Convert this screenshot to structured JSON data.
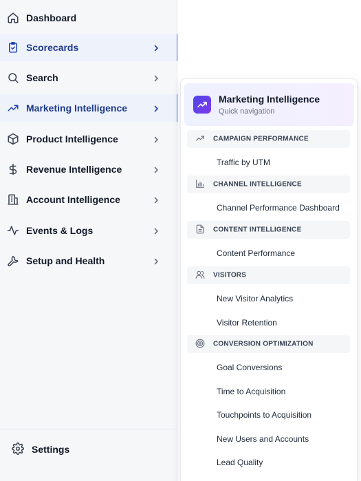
{
  "sidebar": {
    "items": [
      {
        "label": "Dashboard",
        "icon": "home-icon"
      },
      {
        "label": "Scorecards",
        "icon": "clipboard-check-icon"
      },
      {
        "label": "Search",
        "icon": "search-icon"
      },
      {
        "label": "Marketing Intelligence",
        "icon": "trend-up-icon"
      },
      {
        "label": "Product Intelligence",
        "icon": "cube-icon"
      },
      {
        "label": "Revenue Intelligence",
        "icon": "dollar-icon"
      },
      {
        "label": "Account Intelligence",
        "icon": "building-icon"
      },
      {
        "label": "Events & Logs",
        "icon": "activity-icon"
      },
      {
        "label": "Setup and Health",
        "icon": "wrench-icon"
      }
    ],
    "settings_label": "Settings"
  },
  "flyout": {
    "title": "Marketing Intelligence",
    "subtitle": "Quick navigation",
    "sections": [
      {
        "label": "CAMPAIGN PERFORMANCE",
        "icon": "trend-up-icon",
        "links": [
          "Traffic by UTM"
        ]
      },
      {
        "label": "CHANNEL INTELLIGENCE",
        "icon": "bar-chart-icon",
        "links": [
          "Channel Performance Dashboard"
        ]
      },
      {
        "label": "CONTENT INTELLIGENCE",
        "icon": "document-icon",
        "links": [
          "Content Performance"
        ]
      },
      {
        "label": "VISITORS",
        "icon": "users-icon",
        "links": [
          "New Visitor Analytics",
          "Visitor Retention"
        ]
      },
      {
        "label": "CONVERSION OPTIMIZATION",
        "icon": "target-icon",
        "links": [
          "Goal Conversions",
          "Time to Acquisition",
          "Touchpoints to Acquisition",
          "New Users and Accounts",
          "Lead Quality"
        ]
      }
    ]
  },
  "colors": {
    "active_bg": "#eef2fb",
    "active_text": "#1e3a8a",
    "accent": "#3b5bdb",
    "logo_gradient_start": "#4f46e5",
    "logo_gradient_end": "#7c3aed"
  }
}
